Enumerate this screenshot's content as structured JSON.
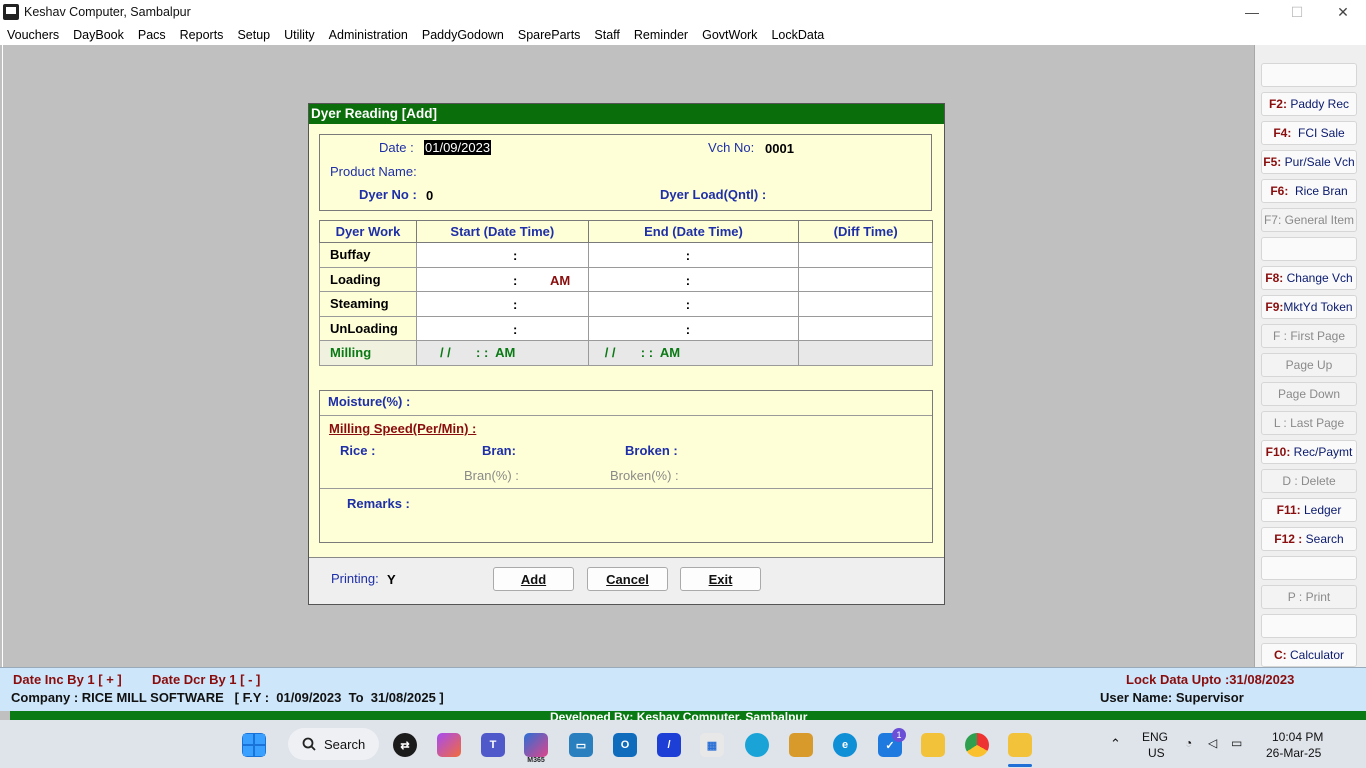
{
  "window": {
    "title": "Keshav Computer, Sambalpur",
    "controls": {
      "minimize": "—",
      "maximize": "☐",
      "close": "✕"
    }
  },
  "menu": [
    "Vouchers",
    "DayBook",
    "Pacs",
    "Reports",
    "Setup",
    "Utility",
    "Administration",
    "PaddyGodown",
    "SpareParts",
    "Staff",
    "Reminder",
    "GovtWork",
    "LockData"
  ],
  "sidebar": {
    "buttons": [
      {
        "key": "",
        "label": "",
        "state": "blank"
      },
      {
        "key": "F2:",
        "label": "Paddy Rec",
        "state": "enabled"
      },
      {
        "key": "F4:",
        "label": "FCI Sale",
        "state": "enabled"
      },
      {
        "key": "F5:",
        "label": "Pur/Sale Vch",
        "state": "enabled"
      },
      {
        "key": "F6:",
        "label": "Rice Bran",
        "state": "enabled"
      },
      {
        "key": "F7:",
        "label": "General Item",
        "state": "disabled"
      },
      {
        "key": "",
        "label": "",
        "state": "blank"
      },
      {
        "key": "F8:",
        "label": "Change  Vch",
        "state": "enabled"
      },
      {
        "key": "F9:",
        "label": "MktYd Token",
        "state": "enabled"
      },
      {
        "key": "F :",
        "label": "First Page",
        "state": "disabled"
      },
      {
        "key": "",
        "label": "Page Up",
        "state": "disabled"
      },
      {
        "key": "",
        "label": "Page Down",
        "state": "disabled"
      },
      {
        "key": "L :",
        "label": "Last Page",
        "state": "disabled"
      },
      {
        "key": "F10:",
        "label": "Rec/Paymt",
        "state": "enabled"
      },
      {
        "key": "D :",
        "label": "Delete",
        "state": "disabled"
      },
      {
        "key": "F11:",
        "label": "Ledger",
        "state": "enabled"
      },
      {
        "key": "F12 :",
        "label": "Search",
        "state": "enabled"
      },
      {
        "key": "",
        "label": "",
        "state": "blank"
      },
      {
        "key": "P :",
        "label": "Print",
        "state": "disabled"
      },
      {
        "key": "",
        "label": "",
        "state": "blank"
      },
      {
        "key": "C:",
        "label": "Calculator",
        "state": "enabled"
      }
    ]
  },
  "dialog": {
    "title": "Dyer Reading [Add]",
    "date_label": "Date :",
    "date_value": "01/09/2023",
    "vch_label": "Vch No:",
    "vch_value": "0001",
    "product_label": "Product Name:",
    "dyer_no_label": "Dyer No :",
    "dyer_no_value": "0",
    "dyer_load_label": "Dyer Load(Qntl) :",
    "grid": {
      "headers": [
        "Dyer Work",
        "Start (Date Time)",
        "End (Date Time)",
        "(Diff Time)"
      ],
      "rows": [
        {
          "label": "Buffay",
          "start_colon": ":",
          "start_ampm": "",
          "end_colon": ":"
        },
        {
          "label": "Loading",
          "start_colon": ":",
          "start_ampm": "AM",
          "end_colon": ":"
        },
        {
          "label": "Steaming",
          "start_colon": ":",
          "start_ampm": "",
          "end_colon": ":"
        },
        {
          "label": "UnLoading",
          "start_colon": ":",
          "start_ampm": "",
          "end_colon": ":"
        }
      ],
      "milling": {
        "label": "Milling",
        "start": "/ /       : :  AM",
        "end": "/ /       : :  AM"
      }
    },
    "moisture_label": "Moisture(%) :",
    "milling_speed_label": "Milling Speed(Per/Min) :",
    "rice_label": "Rice :",
    "bran_label": "Bran:",
    "broken_label": "Broken :",
    "bran_pct_label": "Bran(%) :",
    "broken_pct_label": "Broken(%) :",
    "remarks_label": "Remarks :",
    "printing_label": "Printing:",
    "printing_value": "Y",
    "buttons": {
      "add": "Add",
      "cancel": "Cancel",
      "exit": "Exit"
    }
  },
  "status": {
    "date_inc": "Date Inc By 1 [ + ]",
    "date_dcr": "Date Dcr By 1 [ - ]",
    "lock_data": "Lock Data Upto :31/08/2023",
    "company": "Company : RICE MILL SOFTWARE   [ F.Y :  01/09/2023  To  31/08/2025 ]",
    "user": "User Name: Supervisor",
    "developed_by": "Developed By: Keshav Computer, Sambalpur"
  },
  "taskbar": {
    "search_label": "Search",
    "language": "ENG",
    "region": "US",
    "time": "10:04 PM",
    "date": "26-Mar-25",
    "teams_badge": "1",
    "m365_label": "M365"
  },
  "colors": {
    "dialog_title": "#0a6e0a",
    "label_blue": "#1e2fa8",
    "key_red": "#8a0d0d",
    "status_bg": "#cde6fa",
    "milling_green": "#0a7a14"
  }
}
